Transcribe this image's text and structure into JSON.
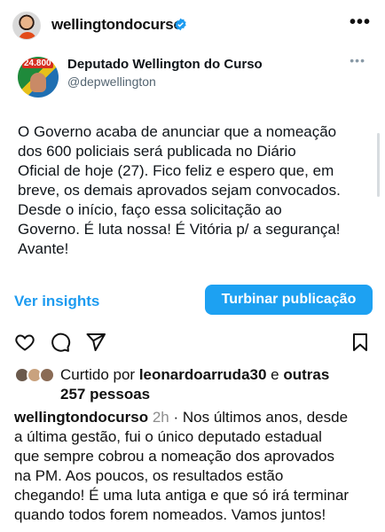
{
  "post": {
    "username": "wellingtondocurso",
    "more_icon": "more-horizontal-icon"
  },
  "tweet": {
    "avatar_badge": "24.800",
    "name": "Deputado Wellington do Curso",
    "handle": "@depwellington",
    "lines": [
      "O Governo acaba de anunciar que a nomeação",
      "dos 600 policiais será publicada no Diário",
      "Oficial de hoje (27). Fico feliz e espero que, em",
      "breve, os demais aprovados sejam convocados.",
      "Desde o início, faço essa solicitação ao",
      "Governo. É luta nossa! É Vitória p/ a segurança!",
      "Avante!"
    ]
  },
  "buttons": {
    "insights": "Ver insights",
    "boost": "Turbinar publicação"
  },
  "likes": {
    "prefix": "Curtido por ",
    "user": "leonardoarruda30",
    "joiner": " e ",
    "others": "outras",
    "count": "257 pessoas"
  },
  "caption": {
    "user": "wellingtondocurso",
    "time": "2h",
    "first_line_text": " · Nos últimos anos, desde",
    "lines": [
      "a última gestão, fui o único deputado estadual",
      "que sempre cobrou a nomeação dos aprovados",
      "na PM. Aos poucos, os resultados estão",
      "chegando! É uma luta antiga e que só irá terminar",
      "quando todos forem nomeados. Vamos juntos!"
    ]
  },
  "colors": {
    "accent": "#1d9bf0",
    "button": "#1da1f2",
    "muted": "#8e8e8e"
  }
}
